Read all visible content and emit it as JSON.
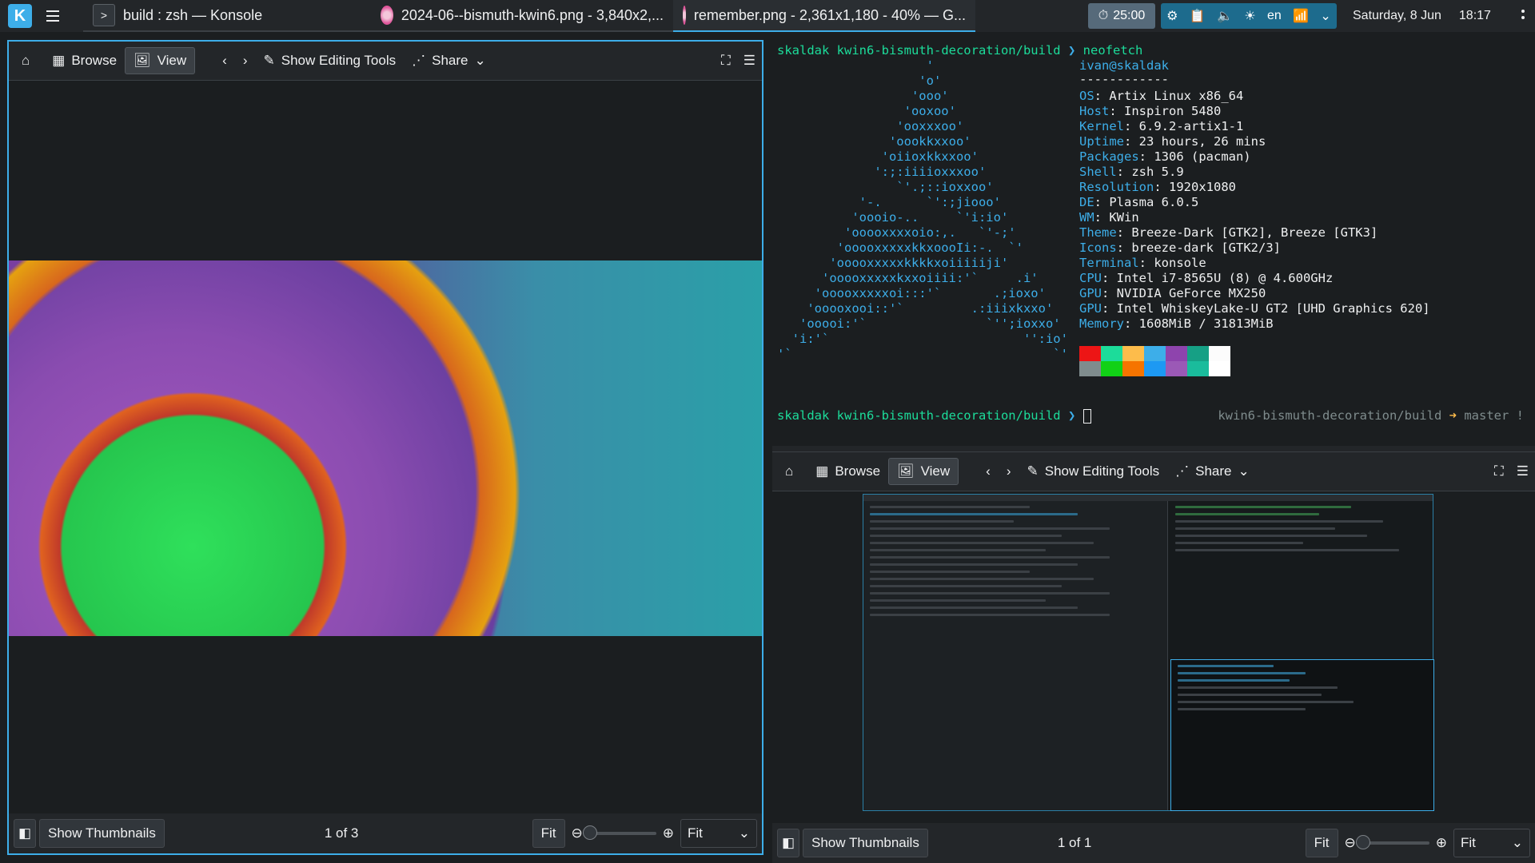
{
  "panel": {
    "tasks": [
      {
        "label": "build : zsh — Konsole"
      },
      {
        "label": "2024-06--bismuth-kwin6.png - 3,840x2,..."
      },
      {
        "label": "remember.png - 2,361x1,180 - 40% — G..."
      }
    ],
    "timer": "25:00",
    "keyboard_layout": "en",
    "date": "Saturday, 8 Jun",
    "time": "18:17"
  },
  "gwenview_left": {
    "toolbar": {
      "browse": "Browse",
      "view": "View",
      "editing": "Show Editing Tools",
      "share": "Share"
    },
    "footer": {
      "thumbnails": "Show Thumbnails",
      "position": "1 of 3",
      "fit_button": "Fit",
      "fit_select": "Fit"
    },
    "zoom_fraction": 0
  },
  "gwenview_right": {
    "toolbar": {
      "browse": "Browse",
      "view": "View",
      "editing": "Show Editing Tools",
      "share": "Share"
    },
    "footer": {
      "thumbnails": "Show Thumbnails",
      "position": "1 of 1",
      "fit_button": "Fit",
      "fit_select": "Fit"
    },
    "zoom_fraction": 0
  },
  "terminal": {
    "prompt_host": "skaldak",
    "prompt_path": "kwin6-bismuth-decoration/build",
    "prompt_arrow": "❯",
    "command": "neofetch",
    "user_at_host": "ivan@skaldak",
    "underline": "------------",
    "info": [
      {
        "key": "OS",
        "value": "Artix Linux x86_64"
      },
      {
        "key": "Host",
        "value": "Inspiron 5480"
      },
      {
        "key": "Kernel",
        "value": "6.9.2-artix1-1"
      },
      {
        "key": "Uptime",
        "value": "23 hours, 26 mins"
      },
      {
        "key": "Packages",
        "value": "1306 (pacman)"
      },
      {
        "key": "Shell",
        "value": "zsh 5.9"
      },
      {
        "key": "Resolution",
        "value": "1920x1080"
      },
      {
        "key": "DE",
        "value": "Plasma 6.0.5"
      },
      {
        "key": "WM",
        "value": "KWin"
      },
      {
        "key": "Theme",
        "value": "Breeze-Dark [GTK2], Breeze [GTK3]"
      },
      {
        "key": "Icons",
        "value": "breeze-dark [GTK2/3]"
      },
      {
        "key": "Terminal",
        "value": "konsole"
      },
      {
        "key": "CPU",
        "value": "Intel i7-8565U (8) @ 4.600GHz"
      },
      {
        "key": "GPU",
        "value": "NVIDIA GeForce MX250"
      },
      {
        "key": "GPU",
        "value": "Intel WhiskeyLake-U GT2 [UHD Graphics 620]"
      },
      {
        "key": "Memory",
        "value": "1608MiB / 31813MiB"
      }
    ],
    "ascii_art": "                    '\n                   'o'\n                  'ooo'\n                 'ooxoo'\n                'ooxxxoo'\n               'oookkxxoo'\n              'oiioxkkxxoo'\n             ':;:iiiioxxxoo'\n                `'.;::ioxxoo'\n           '-.      `':;jiooo'\n          'oooio-..     `'i:io'\n         'ooooxxxxoio:,.   `'-;'\n        'ooooxxxxxkkxoooIi:-.  `'\n       'ooooxxxxxkkkkxoiiiiiji'\n      'ooooxxxxxkxxoiiii:'`     .i'\n     'ooooxxxxxoi:::'`       .;ioxo'\n    'ooooxooi::'`         .:iiixkxxo'\n   'ooooi:'`                `'';ioxxo'\n  'i:'`                          '':io'\n'`                                   `'",
    "right_prompt_path": "kwin6-bismuth-decoration/build",
    "right_prompt_arrow": "➜",
    "right_prompt_branch": "master !",
    "color_swatches": [
      "#7f8c8d",
      "#ed1515",
      "#11d116",
      "#1cdc9a",
      "#f67400",
      "#fdbc4b",
      "#1d99f3",
      "#3daee9",
      "#9b59b6",
      "#8e44ad",
      "#1abc9c",
      "#16a085",
      "#ffffff",
      "#fcfcfc"
    ]
  }
}
